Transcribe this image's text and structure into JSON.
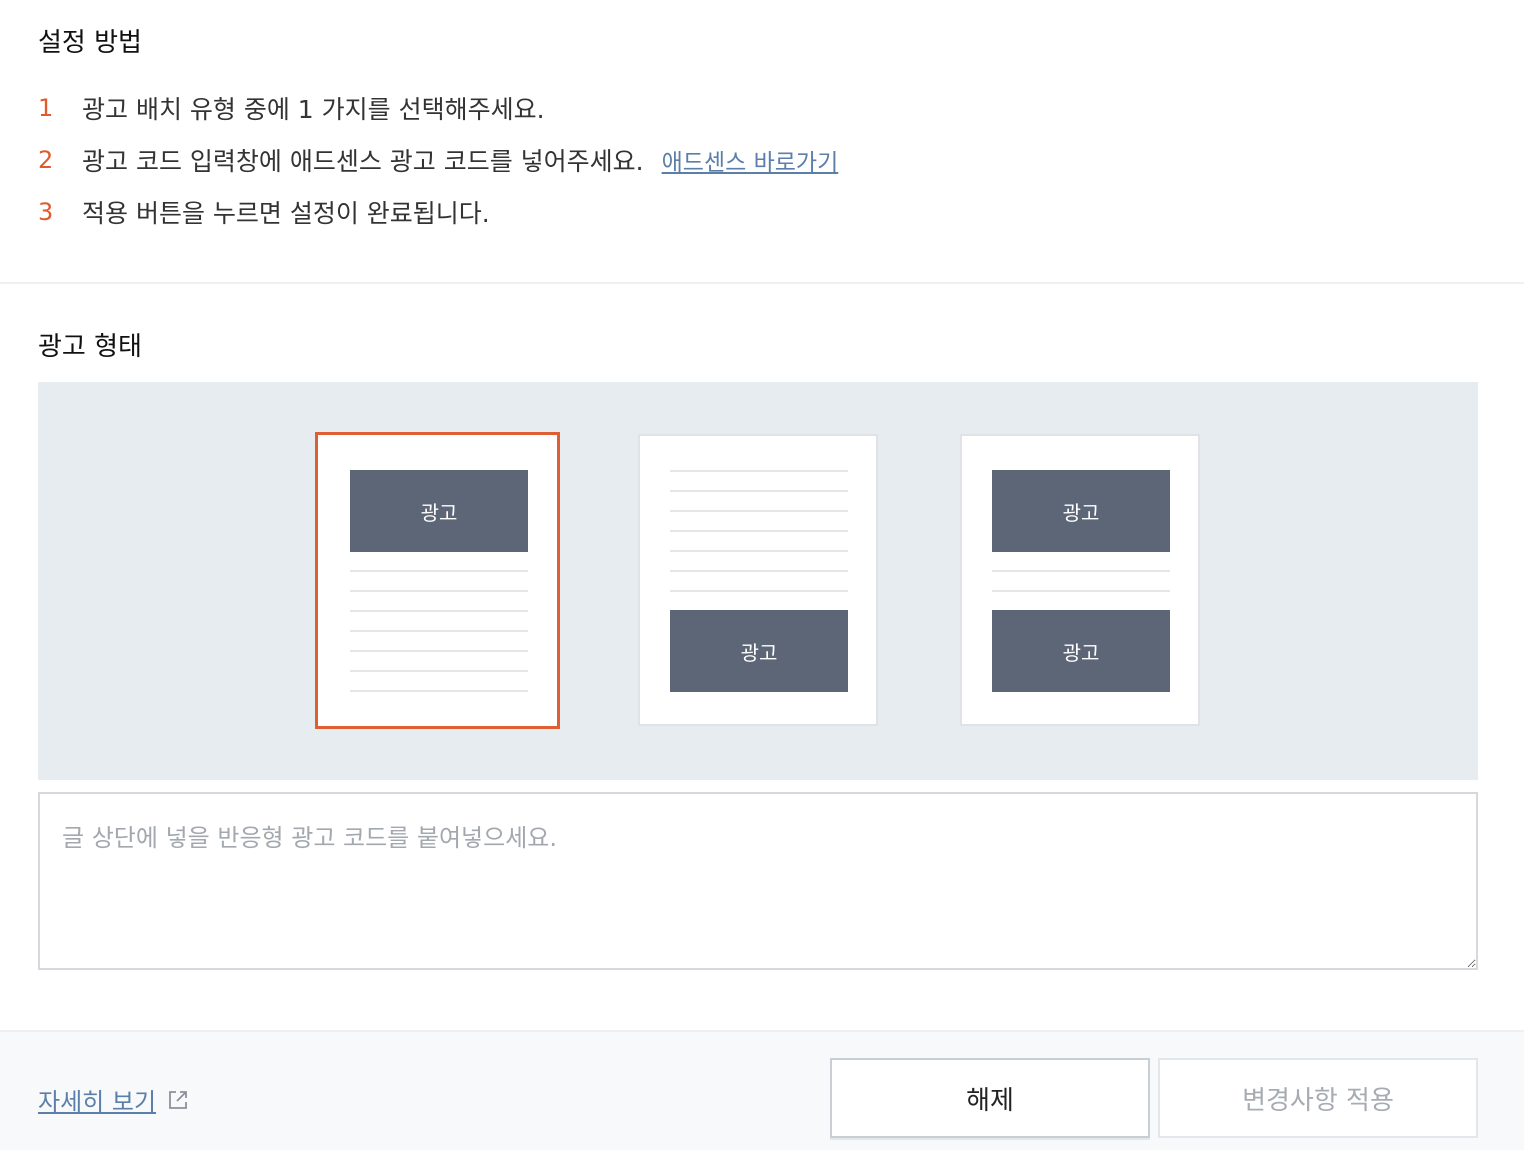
{
  "setup": {
    "title": "설정 방법",
    "steps": [
      {
        "num": "1",
        "text": "광고 배치 유형 중에 1 가지를 선택해주세요."
      },
      {
        "num": "2",
        "text": "광고 코드 입력창에 애드센스 광고 코드를 넣어주세요.",
        "link": "애드센스 바로가기"
      },
      {
        "num": "3",
        "text": "적용 버튼을 누르면 설정이 완료됩니다."
      }
    ]
  },
  "ad_type": {
    "title": "광고 형태",
    "ad_label": "광고",
    "selected_index": 0,
    "accent_color": "#dd5f33",
    "ad_block_color": "#5c6677"
  },
  "code_input": {
    "placeholder": "글 상단에 넣을 반응형 광고 코드를 붙여넣으세요.",
    "value": ""
  },
  "footer": {
    "more_link": "자세히 보기",
    "more_icon": "external-link-icon",
    "release_button": "해제",
    "apply_button": "변경사항 적용"
  }
}
